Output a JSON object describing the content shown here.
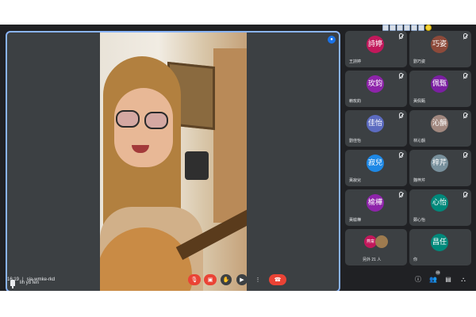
{
  "main_speaker": {
    "name": "lin yu fen"
  },
  "participants": [
    {
      "avatar_text": "詩婷",
      "name": "王詩婷",
      "color": "#c2185b"
    },
    {
      "avatar_text": "巧姿",
      "name": "劉巧姿",
      "color": "#8d4a3a"
    },
    {
      "avatar_text": "玫鈞",
      "name": "賴玫鈞",
      "color": "#8e24aa"
    },
    {
      "avatar_text": "佩甄",
      "name": "黃佩甄",
      "color": "#7b1fa2"
    },
    {
      "avatar_text": "佳怡",
      "name": "劉佳怡",
      "color": "#5c6bc0"
    },
    {
      "avatar_text": "沁韻",
      "name": "林沁韻",
      "color": "#a1887f"
    },
    {
      "avatar_text": "寂兒",
      "name": "黃寂兒",
      "color": "#1e88e5"
    },
    {
      "avatar_text": "梓芹",
      "name": "魏梓芹",
      "color": "#78909c"
    },
    {
      "avatar_text": "榆樺",
      "name": "黃榆樺",
      "color": "#8e24aa"
    },
    {
      "avatar_text": "心怡",
      "name": "鄭心怡",
      "color": "#00897b"
    }
  ],
  "more_tile": {
    "label": "另外 21 人",
    "avatar_text": "燕甯",
    "avatar_color": "#c2185b"
  },
  "self_tile": {
    "avatar_text": "昌任",
    "name": "你",
    "color": "#00897b"
  },
  "bottom_bar": {
    "time": "16:19",
    "separator": "|",
    "meeting_code": "sja-wmke-rkd",
    "people_count": "33"
  }
}
